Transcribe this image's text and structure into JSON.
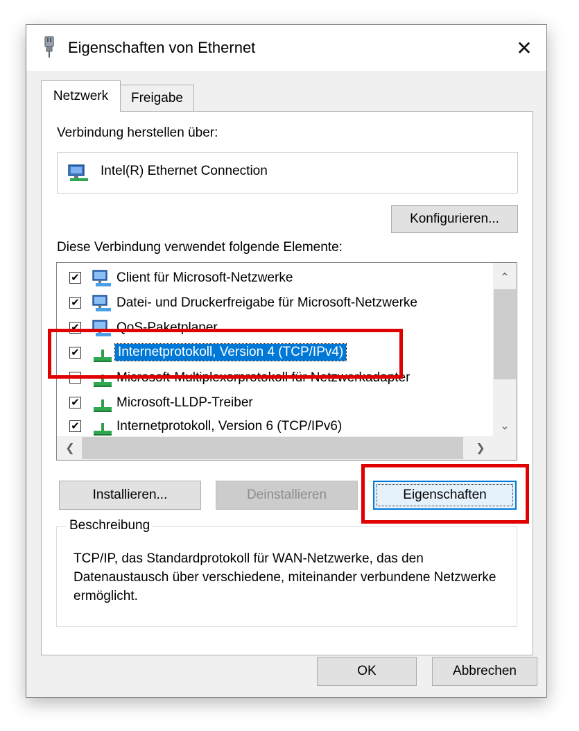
{
  "window": {
    "title": "Eigenschaften von Ethernet",
    "title_icon": "network-cable-plug-icon",
    "close_glyph": "✕"
  },
  "tabs": [
    {
      "label": "Netzwerk",
      "active": true
    },
    {
      "label": "Freigabe",
      "active": false
    }
  ],
  "connection": {
    "label": "Verbindung herstellen über:",
    "adapter_name": "Intel(R) Ethernet Connection",
    "adapter_icon": "network-adapter-icon",
    "configure_button": "Konfigurieren..."
  },
  "components": {
    "label": "Diese Verbindung verwendet folgende Elemente:",
    "items": [
      {
        "label": "Client für Microsoft-Netzwerke",
        "checked": true,
        "icon": "computers-icon",
        "selected": false
      },
      {
        "label": "Datei- und Druckerfreigabe für Microsoft-Netzwerke",
        "checked": true,
        "icon": "computers-icon",
        "selected": false
      },
      {
        "label": "QoS-Paketplaner",
        "checked": true,
        "icon": "computers-icon",
        "selected": false
      },
      {
        "label": "Internetprotokoll, Version 4 (TCP/IPv4)",
        "checked": true,
        "icon": "protocol-icon",
        "selected": true
      },
      {
        "label": "Microsoft-Multiplexorprotokoll für Netzwerkadapter",
        "checked": false,
        "icon": "protocol-icon",
        "selected": false
      },
      {
        "label": "Microsoft-LLDP-Treiber",
        "checked": true,
        "icon": "protocol-icon",
        "selected": false
      },
      {
        "label": "Internetprotokoll, Version 6 (TCP/IPv6)",
        "checked": true,
        "icon": "protocol-icon",
        "selected": false
      }
    ],
    "check_glyph": "✔"
  },
  "actions": {
    "install": "Installieren...",
    "uninstall": "Deinstallieren",
    "properties": "Eigenschaften"
  },
  "description": {
    "legend": "Beschreibung",
    "text": "TCP/IP, das Standardprotokoll für WAN-Netzwerke, das den Datenaustausch über verschiedene, miteinander verbundene Netzwerke ermöglicht."
  },
  "footer": {
    "ok": "OK",
    "cancel": "Abbrechen"
  },
  "colors": {
    "selection": "#0078d7",
    "highlight_box": "#e00000",
    "dialog_bg": "#f0f0f0"
  }
}
